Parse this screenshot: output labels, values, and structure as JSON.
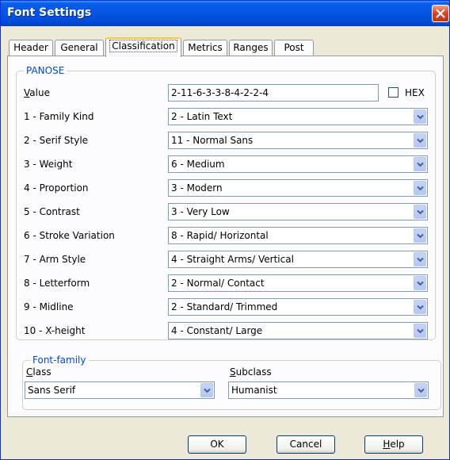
{
  "window": {
    "title": "Font Settings"
  },
  "tabs": [
    {
      "label": "Header"
    },
    {
      "label": "General"
    },
    {
      "label": "Classification"
    },
    {
      "label": "Metrics"
    },
    {
      "label": "Ranges"
    },
    {
      "label": "Post"
    }
  ],
  "active_tab": "Classification",
  "panose": {
    "group_title": "PANOSE",
    "value_label_first": "V",
    "value_label_rest": "alue",
    "value": "2-11-6-3-3-8-4-2-2-4",
    "hex_label": "HEX",
    "hex_checked": false,
    "rows": [
      {
        "label": "1 - Family Kind",
        "value": "2 - Latin Text"
      },
      {
        "label": "2 - Serif Style",
        "value": "11 - Normal Sans"
      },
      {
        "label": "3 - Weight",
        "value": "6 - Medium"
      },
      {
        "label": "4 - Proportion",
        "value": "3 - Modern"
      },
      {
        "label": "5 - Contrast",
        "value": "3 - Very Low"
      },
      {
        "label": "6 - Stroke Variation",
        "value": "8 - Rapid/ Horizontal"
      },
      {
        "label": "7 - Arm Style",
        "value": "4 - Straight Arms/ Vertical"
      },
      {
        "label": "8 - Letterform",
        "value": "2 - Normal/ Contact"
      },
      {
        "label": "9 - Midline",
        "value": "2 - Standard/ Trimmed"
      },
      {
        "label": "10 - X-height",
        "value": "4 - Constant/ Large"
      }
    ]
  },
  "font_family": {
    "group_title": "Font-family",
    "class_label_first": "C",
    "class_label_rest": "lass",
    "class_value": "Sans Serif",
    "subclass_label_first": "S",
    "subclass_label_rest": "ubclass",
    "subclass_value": "Humanist"
  },
  "buttons": {
    "ok": "OK",
    "cancel": "Cancel",
    "help_first": "H",
    "help_rest": "elp"
  },
  "colors": {
    "titlebar": "#0355e3",
    "group_title": "#0046d5",
    "active_tab_accent": "#ffc83c",
    "close_button": "#d9462a"
  },
  "icons": [
    "close-icon",
    "chevron-down-icon"
  ]
}
